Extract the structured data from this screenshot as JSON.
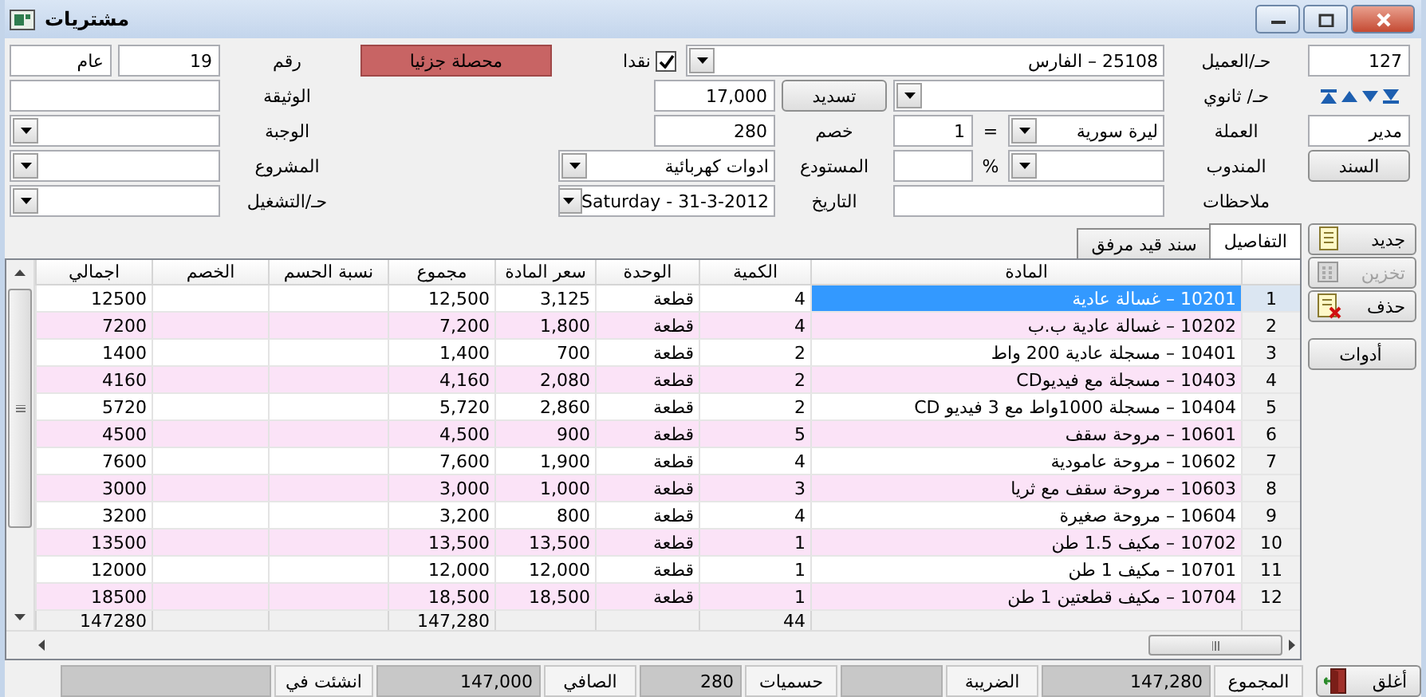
{
  "window": {
    "title": "مشتريات"
  },
  "header": {
    "lines": [
      {
        "items": [
          {
            "kind": "field",
            "value": "127"
          },
          {
            "kind": "label",
            "text": "حـ/العميل"
          },
          {
            "kind": "dropdown",
            "value": "25108 – الفارس"
          },
          {
            "kind": "checkbox",
            "label": "نقدا",
            "checked": true
          },
          {
            "kind": "badge",
            "text": "محصلة جزئيا"
          },
          {
            "kind": "label",
            "text": "رقم"
          },
          {
            "kind": "field",
            "value": "19"
          },
          {
            "kind": "field",
            "value": "عام"
          }
        ]
      },
      {
        "items": [
          {
            "kind": "nav"
          },
          {
            "kind": "label",
            "text": "حـ/ ثانوي"
          },
          {
            "kind": "dropdown"
          },
          {
            "kind": "button",
            "text": "تسديد"
          },
          {
            "kind": "field",
            "value": "17,000"
          },
          {
            "kind": "label",
            "text": "الوثيقة"
          },
          {
            "kind": "field"
          }
        ]
      },
      {
        "items": [
          {
            "kind": "field",
            "value": "مدير"
          },
          {
            "kind": "label",
            "text": "العملة"
          },
          {
            "kind": "dropdown",
            "value": "ليرة سورية"
          },
          {
            "kind": "symbol",
            "text": "="
          },
          {
            "kind": "field",
            "value": "1"
          },
          {
            "kind": "label",
            "text": "خصم"
          },
          {
            "kind": "field",
            "value": "280"
          },
          {
            "kind": "label",
            "text": "الوجبة"
          },
          {
            "kind": "dropdown"
          }
        ]
      },
      {
        "items": [
          {
            "kind": "button",
            "text": "السند"
          },
          {
            "kind": "label",
            "text": "المندوب"
          },
          {
            "kind": "dropdown"
          },
          {
            "kind": "symbol",
            "text": "%"
          },
          {
            "kind": "field"
          },
          {
            "kind": "label",
            "text": "المستودع"
          },
          {
            "kind": "dropdown",
            "value": "ادوات كهربائية"
          },
          {
            "kind": "label",
            "text": "المشروع"
          },
          {
            "kind": "dropdown"
          }
        ]
      },
      {
        "items": [
          {
            "kind": "label",
            "text": "ملاحظات"
          },
          {
            "kind": "field"
          },
          {
            "kind": "label",
            "text": "التاريخ"
          },
          {
            "kind": "dropdown",
            "value": "Saturday - 31-3-2012"
          },
          {
            "kind": "label",
            "text": "حـ/التشغيل"
          },
          {
            "kind": "dropdown"
          }
        ]
      }
    ]
  },
  "tabs": [
    {
      "label": "التفاصيل",
      "selected": true
    },
    {
      "label": "سند قيد مرفق",
      "selected": false
    }
  ],
  "side_buttons": [
    {
      "label": "جديد",
      "disabled": false
    },
    {
      "label": "تخزين",
      "disabled": true
    },
    {
      "label": "حذف",
      "disabled": false
    },
    {
      "label": "أدوات",
      "disabled": false
    }
  ],
  "table": {
    "columns": [
      "",
      "المادة",
      "الكمية",
      "الوحدة",
      "سعر المادة",
      "مجموع",
      "نسبة الحسم",
      "الخصم",
      "اجمالي"
    ],
    "rows": [
      {
        "selected": true,
        "cells": [
          "1",
          "10201 – غسالة عادية",
          "4",
          "قطعة",
          "3,125",
          "12,500",
          "",
          "",
          "12500"
        ]
      },
      {
        "selected": false,
        "cells": [
          "2",
          "10202 – غسالة عادية ب.ب",
          "4",
          "قطعة",
          "1,800",
          "7,200",
          "",
          "",
          "7200"
        ]
      },
      {
        "selected": false,
        "cells": [
          "3",
          "10401 – مسجلة عادية 200 واط",
          "2",
          "قطعة",
          "700",
          "1,400",
          "",
          "",
          "1400"
        ]
      },
      {
        "selected": false,
        "cells": [
          "4",
          "10403 – مسجلة مع فيديوCD",
          "2",
          "قطعة",
          "2,080",
          "4,160",
          "",
          "",
          "4160"
        ]
      },
      {
        "selected": false,
        "cells": [
          "5",
          "10404 – مسجلة 1000واط مع 3 فيديو CD",
          "2",
          "قطعة",
          "2,860",
          "5,720",
          "",
          "",
          "5720"
        ]
      },
      {
        "selected": false,
        "cells": [
          "6",
          "10601 – مروحة سقف",
          "5",
          "قطعة",
          "900",
          "4,500",
          "",
          "",
          "4500"
        ]
      },
      {
        "selected": false,
        "cells": [
          "7",
          "10602 – مروحة عامودية",
          "4",
          "قطعة",
          "1,900",
          "7,600",
          "",
          "",
          "7600"
        ]
      },
      {
        "selected": false,
        "cells": [
          "8",
          "10603 – مروحة سقف مع ثريا",
          "3",
          "قطعة",
          "1,000",
          "3,000",
          "",
          "",
          "3000"
        ]
      },
      {
        "selected": false,
        "cells": [
          "9",
          "10604 – مروحة صغيرة",
          "4",
          "قطعة",
          "800",
          "3,200",
          "",
          "",
          "3200"
        ]
      },
      {
        "selected": false,
        "cells": [
          "10",
          "10702 – مكيف 1.5 طن",
          "1",
          "قطعة",
          "13,500",
          "13,500",
          "",
          "",
          "13500"
        ]
      },
      {
        "selected": false,
        "cells": [
          "11",
          "10701 – مكيف 1 طن",
          "1",
          "قطعة",
          "12,000",
          "12,000",
          "",
          "",
          "12000"
        ]
      },
      {
        "selected": false,
        "cells": [
          "12",
          "10704 – مكيف قطعتين 1 طن",
          "1",
          "قطعة",
          "18,500",
          "18,500",
          "",
          "",
          "18500"
        ]
      }
    ],
    "totals": {
      "quantity": "44",
      "total": "147,280",
      "net_total": "147280"
    }
  },
  "close_button": {
    "label": "أغلق"
  },
  "status_bar": [
    {
      "kind": "label",
      "text": "المجموع"
    },
    {
      "kind": "value",
      "text": "147,280"
    },
    {
      "kind": "label",
      "text": "الضريبة"
    },
    {
      "kind": "value"
    },
    {
      "kind": "label",
      "text": "حسميات"
    },
    {
      "kind": "value",
      "text": "280"
    },
    {
      "kind": "label",
      "text": "الصافي"
    },
    {
      "kind": "value",
      "text": "147,000"
    },
    {
      "kind": "label",
      "text": "انشئت في"
    },
    {
      "kind": "value"
    }
  ]
}
